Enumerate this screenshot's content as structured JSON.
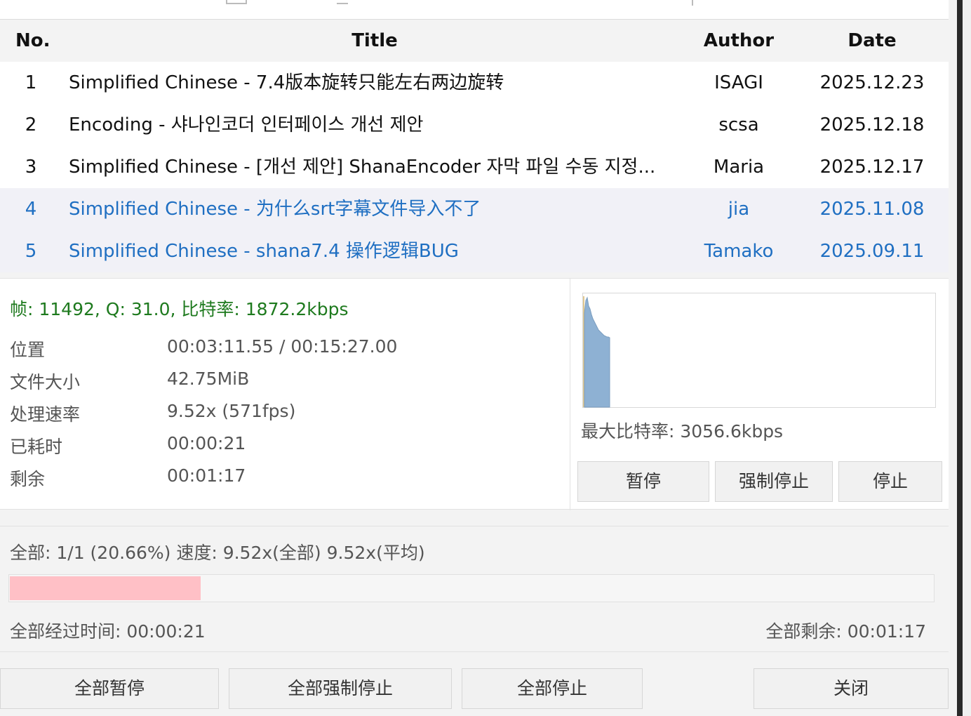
{
  "table": {
    "headers": {
      "no": "No.",
      "title": "Title",
      "author": "Author",
      "date": "Date"
    },
    "rows": [
      {
        "no": "1",
        "title": "Simplified Chinese - 7.4版本旋转只能左右两边旋转",
        "author": "ISAGI",
        "date": "2025.12.23",
        "selected": false
      },
      {
        "no": "2",
        "title": "Encoding - 샤나인코더 인터페이스 개선 제안",
        "author": "scsa",
        "date": "2025.12.18",
        "selected": false
      },
      {
        "no": "3",
        "title": "Simplified Chinese - [개선 제안] ShanaEncoder 자막 파일 수동 지정...",
        "author": "Maria",
        "date": "2025.12.17",
        "selected": false
      },
      {
        "no": "4",
        "title": "Simplified Chinese - 为什么srt字幕文件导入不了",
        "author": "jia",
        "date": "2025.11.08",
        "selected": true
      },
      {
        "no": "5",
        "title": "Simplified Chinese - shana7.4 操作逻辑BUG",
        "author": "Tamako",
        "date": "2025.09.11",
        "selected": true
      }
    ]
  },
  "detail": {
    "stats": "帧: 11492, Q: 31.0, 比特率: 1872.2kbps",
    "items": [
      {
        "label": "位置",
        "value": "00:03:11.55 / 00:15:27.00"
      },
      {
        "label": "文件大小",
        "value": "42.75MiB"
      },
      {
        "label": "处理速率",
        "value": "9.52x (571fps)"
      },
      {
        "label": "已耗时",
        "value": "00:00:21"
      },
      {
        "label": "剩余",
        "value": "00:01:17"
      }
    ],
    "max_bitrate": "最大比特率: 3056.6kbps",
    "buttons": {
      "pause": "暂停",
      "force_stop": "强制停止",
      "stop": "停止"
    }
  },
  "overall": {
    "summary": "全部: 1/1 (20.66%) 速度: 9.52x(全部) 9.52x(平均)",
    "progress": 0.2066,
    "elapsed": "全部经过时间: 00:00:21",
    "remaining": "全部剩余: 00:01:17"
  },
  "footer_buttons": {
    "pause_all": "全部暂停",
    "force_stop_all": "全部强制停止",
    "stop_all": "全部停止",
    "close": "关闭"
  },
  "colors": {
    "selected_text": "#1f6fc2",
    "stats_text": "#1e7a1e",
    "progress_fill": "#ffc0c6",
    "graph_fill": "#8eb1d3"
  }
}
